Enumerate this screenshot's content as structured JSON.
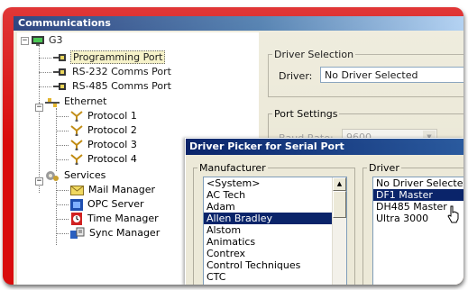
{
  "window": {
    "title": "Communications"
  },
  "tree": {
    "root": "G3",
    "items": [
      {
        "label": "Programming Port",
        "icon": "port-icon"
      },
      {
        "label": "RS-232 Comms Port",
        "icon": "port-icon"
      },
      {
        "label": "RS-485 Comms Port",
        "icon": "port-icon"
      },
      {
        "label": "Ethernet",
        "icon": "network-icon"
      },
      {
        "label": "Protocol 1",
        "icon": "protocol-icon"
      },
      {
        "label": "Protocol 2",
        "icon": "protocol-icon"
      },
      {
        "label": "Protocol 3",
        "icon": "protocol-icon"
      },
      {
        "label": "Protocol 4",
        "icon": "protocol-icon"
      },
      {
        "label": "Services",
        "icon": "services-icon"
      },
      {
        "label": "Mail Manager",
        "icon": "mail-icon"
      },
      {
        "label": "OPC Server",
        "icon": "opc-icon"
      },
      {
        "label": "Time Manager",
        "icon": "clock-icon"
      },
      {
        "label": "Sync Manager",
        "icon": "sync-icon"
      }
    ],
    "selected": "Programming Port"
  },
  "driver_selection": {
    "group_label": "Driver Selection",
    "driver_label": "Driver:",
    "driver_value": "No Driver Selected"
  },
  "port_settings": {
    "group_label": "Port Settings",
    "baud_label": "Baud Rate:",
    "baud_value": "9600"
  },
  "dialog": {
    "title": "Driver Picker for Serial Port",
    "manufacturer_label": "Manufacturer",
    "driver_label": "Driver",
    "manufacturers": [
      "<System>",
      "AC Tech",
      "Adam",
      "Allen Bradley",
      "Alstom",
      "Animatics",
      "Contrex",
      "Control Techniques",
      "CTC"
    ],
    "selected_manufacturer": "Allen Bradley",
    "drivers": [
      "No Driver Selected",
      "DF1 Master",
      "DH485 Master",
      "Ultra 3000"
    ],
    "selected_driver": "DF1 Master"
  },
  "colors": {
    "frame": "#d90b0b",
    "selection": "#0a246a",
    "titlebar": "#0a246a"
  }
}
